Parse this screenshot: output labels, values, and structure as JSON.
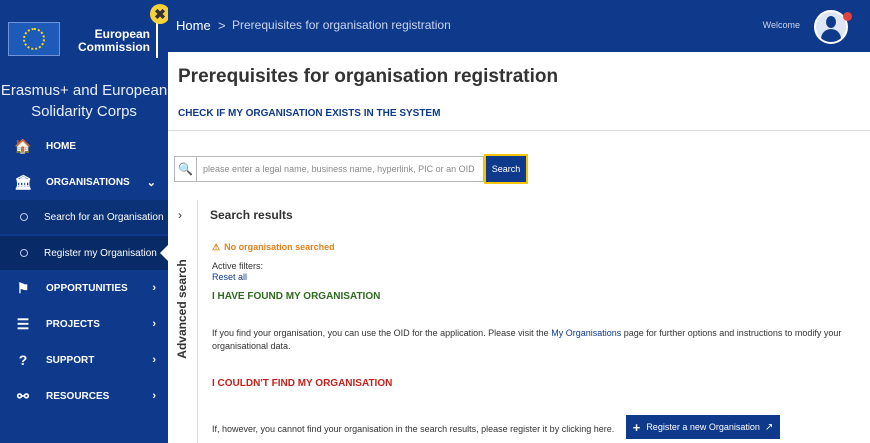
{
  "logo": {
    "line1": "European",
    "line2": "Commission",
    "close_symbol": "✖"
  },
  "sidebar": {
    "title_line1": "Erasmus+ and European",
    "title_line2": "Solidarity Corps",
    "items": [
      {
        "label": "HOME",
        "icon": "home-icon",
        "glyph": "🏠",
        "arrow": ""
      },
      {
        "label": "ORGANISATIONS",
        "icon": "institution-icon",
        "glyph": "🏛",
        "arrow": "⌄"
      },
      {
        "label": "OPPORTUNITIES",
        "icon": "flag-icon",
        "glyph": "⚑",
        "arrow": "›"
      },
      {
        "label": "PROJECTS",
        "icon": "projects-icon",
        "glyph": "☰",
        "arrow": "›"
      },
      {
        "label": "SUPPORT",
        "icon": "question-icon",
        "glyph": "?",
        "arrow": "›"
      },
      {
        "label": "RESOURCES",
        "icon": "resources-icon",
        "glyph": "⚯",
        "arrow": "›"
      }
    ],
    "sub_items": [
      {
        "label": "Search for an Organisation"
      },
      {
        "label": "Register my Organisation"
      }
    ]
  },
  "topbar": {
    "home": "Home",
    "separator": ">",
    "current": "Prerequisites for organisation registration",
    "welcome": "Welcome"
  },
  "main": {
    "page_title": "Prerequisites for organisation registration",
    "check_heading": "CHECK IF MY ORGANISATION EXISTS IN THE SYSTEM",
    "search": {
      "icon_glyph": "🔍",
      "placeholder": "please enter a legal name, business name, hyperlink, PIC or an OID",
      "button": "Search"
    },
    "advanced": {
      "chevron": "›",
      "label": "Advanced search"
    },
    "results_title": "Search results",
    "no_org_icon": "⚠",
    "no_org": "No organisation searched",
    "filters_label": "Active filters:",
    "reset_all": "Reset all",
    "found_heading": "I HAVE FOUND MY ORGANISATION",
    "found_text_before": "If you find your organisation, you can use the OID for the application. Please visit the ",
    "found_text_link": "My Organisations",
    "found_text_after": " page for further options and instructions to modify your organisational data.",
    "notfound_heading": "I COULDN'T FIND MY ORGANISATION",
    "notfound_text": "If, however, you cannot find your organisation in the search results, please register it by clicking here.",
    "register_button": "Register a new Organisation",
    "register_plus": "+",
    "register_ext": "↗"
  },
  "colors": {
    "brand": "#0f3a8c",
    "warning": "#e2811b",
    "found": "#2f6a1f",
    "notfound": "#c5211c",
    "highlight": "#f6c400"
  }
}
